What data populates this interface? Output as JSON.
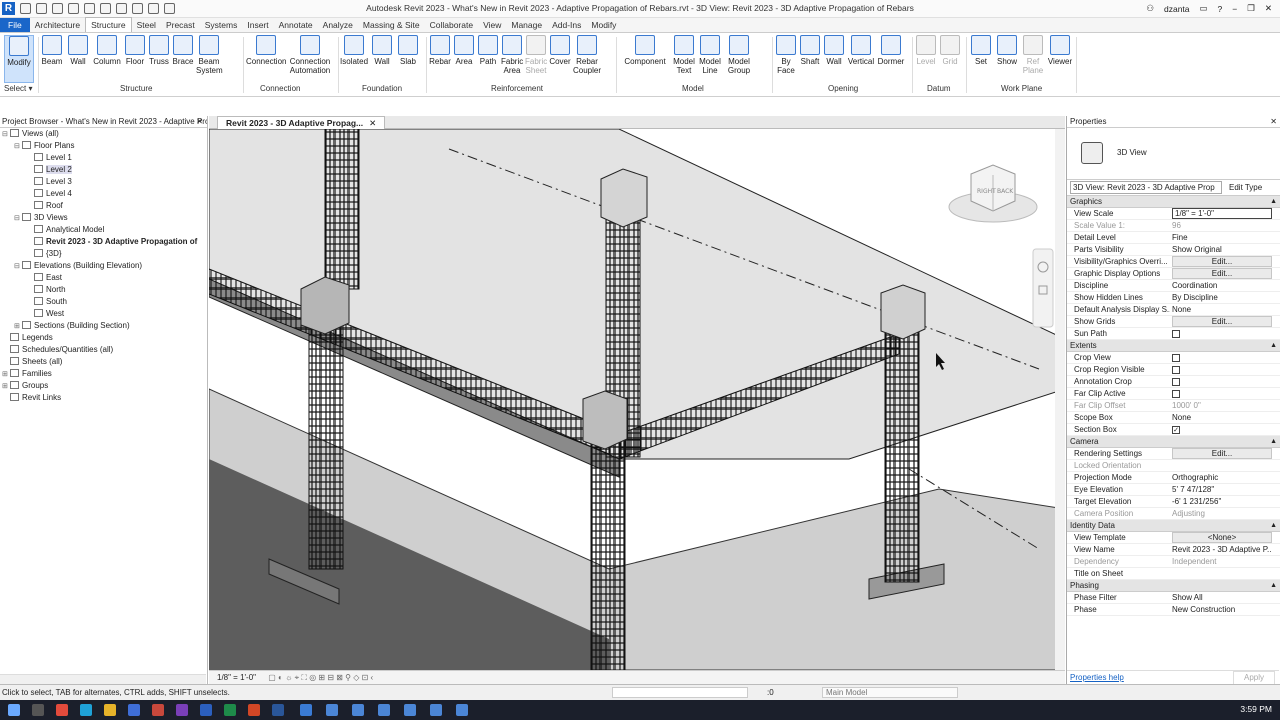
{
  "app": {
    "logo": "R",
    "title": "Autodesk Revit 2023 - What's New in Revit 2023 - Adaptive Propagation of Rebars.rvt - 3D View: Revit 2023 - 3D Adaptive Propagation of Rebars",
    "user": "dzanta"
  },
  "tabs": [
    "File",
    "Architecture",
    "Structure",
    "Steel",
    "Precast",
    "Systems",
    "Insert",
    "Annotate",
    "Analyze",
    "Massing & Site",
    "Collaborate",
    "View",
    "Manage",
    "Add-Ins",
    "Modify"
  ],
  "active_tab": "Structure",
  "ribbon": {
    "modify": "Modify",
    "select": "Select ▾",
    "structure": [
      "Beam",
      "Wall",
      "Column",
      "Floor",
      "Truss",
      "Brace",
      "Beam System"
    ],
    "connection": [
      "Connection",
      "Connection Automation"
    ],
    "foundation": [
      "Isolated",
      "Wall",
      "Slab"
    ],
    "reinforcement": [
      "Rebar",
      "Area",
      "Path",
      "Fabric Area",
      "Fabric Sheet",
      "Cover",
      "Rebar Coupler"
    ],
    "model": [
      "Component",
      "Model Text",
      "Model Line",
      "Model Group"
    ],
    "opening": [
      "By Face",
      "Shaft",
      "Wall",
      "Vertical",
      "Dormer"
    ],
    "datum": [
      "Level",
      "Grid"
    ],
    "workplane": [
      "Set",
      "Show",
      "Ref Plane",
      "Viewer"
    ],
    "panels": [
      "Structure",
      "Connection",
      "Foundation",
      "Reinforcement",
      "Model",
      "Opening",
      "Datum",
      "Work Plane"
    ]
  },
  "project_browser": {
    "title": "Project Browser - What's New in Revit 2023 - Adaptive Propagation...",
    "items": [
      {
        "label": "Views (all)",
        "indent": 0,
        "toggle": "−"
      },
      {
        "label": "Floor Plans",
        "indent": 1,
        "toggle": "−"
      },
      {
        "label": "Level 1",
        "indent": 2,
        "toggle": ""
      },
      {
        "label": "Level 2",
        "indent": 2,
        "toggle": "",
        "selected": true
      },
      {
        "label": "Level 3",
        "indent": 2,
        "toggle": ""
      },
      {
        "label": "Level 4",
        "indent": 2,
        "toggle": ""
      },
      {
        "label": "Roof",
        "indent": 2,
        "toggle": ""
      },
      {
        "label": "3D Views",
        "indent": 1,
        "toggle": "−"
      },
      {
        "label": "Analytical Model",
        "indent": 2,
        "toggle": ""
      },
      {
        "label": "Revit 2023 - 3D Adaptive Propagation of",
        "indent": 2,
        "toggle": "",
        "bold": true
      },
      {
        "label": "{3D}",
        "indent": 2,
        "toggle": ""
      },
      {
        "label": "Elevations (Building Elevation)",
        "indent": 1,
        "toggle": "−"
      },
      {
        "label": "East",
        "indent": 2,
        "toggle": ""
      },
      {
        "label": "North",
        "indent": 2,
        "toggle": ""
      },
      {
        "label": "South",
        "indent": 2,
        "toggle": ""
      },
      {
        "label": "West",
        "indent": 2,
        "toggle": ""
      },
      {
        "label": "Sections (Building Section)",
        "indent": 1,
        "toggle": "+"
      },
      {
        "label": "Legends",
        "indent": 0,
        "toggle": ""
      },
      {
        "label": "Schedules/Quantities (all)",
        "indent": 0,
        "toggle": ""
      },
      {
        "label": "Sheets (all)",
        "indent": 0,
        "toggle": ""
      },
      {
        "label": "Families",
        "indent": 0,
        "toggle": "+"
      },
      {
        "label": "Groups",
        "indent": 0,
        "toggle": "+"
      },
      {
        "label": "Revit Links",
        "indent": 0,
        "toggle": ""
      }
    ]
  },
  "view": {
    "tab_label": "Revit 2023 - 3D Adaptive Propag...",
    "scale": "1/8\" = 1'-0\"",
    "cube_labels": [
      "RIGHT",
      "BACK"
    ]
  },
  "properties": {
    "title": "Properties",
    "type_name": "3D View",
    "instance_selector": "3D View: Revit 2023 - 3D Adaptive Prop",
    "edit_type": "Edit Type",
    "groups": [
      {
        "name": "Graphics",
        "rows": [
          {
            "k": "View Scale",
            "v": "1/8\" = 1'-0\"",
            "kind": "input"
          },
          {
            "k": "Scale Value    1:",
            "v": "96",
            "kind": "gray"
          },
          {
            "k": "Detail Level",
            "v": "Fine"
          },
          {
            "k": "Parts Visibility",
            "v": "Show Original"
          },
          {
            "k": "Visibility/Graphics Overri...",
            "v": "Edit...",
            "kind": "edit"
          },
          {
            "k": "Graphic Display Options",
            "v": "Edit...",
            "kind": "edit"
          },
          {
            "k": "Discipline",
            "v": "Coordination"
          },
          {
            "k": "Show Hidden Lines",
            "v": "By Discipline"
          },
          {
            "k": "Default Analysis Display S...",
            "v": "None"
          },
          {
            "k": "Show Grids",
            "v": "Edit...",
            "kind": "edit"
          },
          {
            "k": "Sun Path",
            "v": "",
            "kind": "check"
          }
        ]
      },
      {
        "name": "Extents",
        "rows": [
          {
            "k": "Crop View",
            "v": "",
            "kind": "check"
          },
          {
            "k": "Crop Region Visible",
            "v": "",
            "kind": "check"
          },
          {
            "k": "Annotation Crop",
            "v": "",
            "kind": "check"
          },
          {
            "k": "Far Clip Active",
            "v": "",
            "kind": "check"
          },
          {
            "k": "Far Clip Offset",
            "v": "1000'  0\"",
            "kind": "gray"
          },
          {
            "k": "Scope Box",
            "v": "None"
          },
          {
            "k": "Section Box",
            "v": "✓",
            "kind": "check"
          }
        ]
      },
      {
        "name": "Camera",
        "rows": [
          {
            "k": "Rendering Settings",
            "v": "Edit...",
            "kind": "edit"
          },
          {
            "k": "Locked Orientation",
            "v": "",
            "kind": "gray"
          },
          {
            "k": "Projection Mode",
            "v": "Orthographic"
          },
          {
            "k": "Eye Elevation",
            "v": "5'  7 47/128\""
          },
          {
            "k": "Target Elevation",
            "v": "-6'  1 231/256\""
          },
          {
            "k": "Camera Position",
            "v": "Adjusting",
            "kind": "gray"
          }
        ]
      },
      {
        "name": "Identity Data",
        "rows": [
          {
            "k": "View Template",
            "v": "<None>",
            "kind": "edit"
          },
          {
            "k": "View Name",
            "v": "Revit 2023 - 3D Adaptive P..."
          },
          {
            "k": "Dependency",
            "v": "Independent",
            "kind": "gray"
          },
          {
            "k": "Title on Sheet",
            "v": ""
          }
        ]
      },
      {
        "name": "Phasing",
        "rows": [
          {
            "k": "Phase Filter",
            "v": "Show All"
          },
          {
            "k": "Phase",
            "v": "New Construction"
          }
        ]
      }
    ],
    "help_link": "Properties help",
    "apply": "Apply"
  },
  "status": {
    "hint": "Click to select, TAB for alternates, CTRL adds, SHIFT unselects.",
    "zero": ":0",
    "model": "Main Model"
  },
  "taskbar": {
    "time": "3:59 PM"
  }
}
